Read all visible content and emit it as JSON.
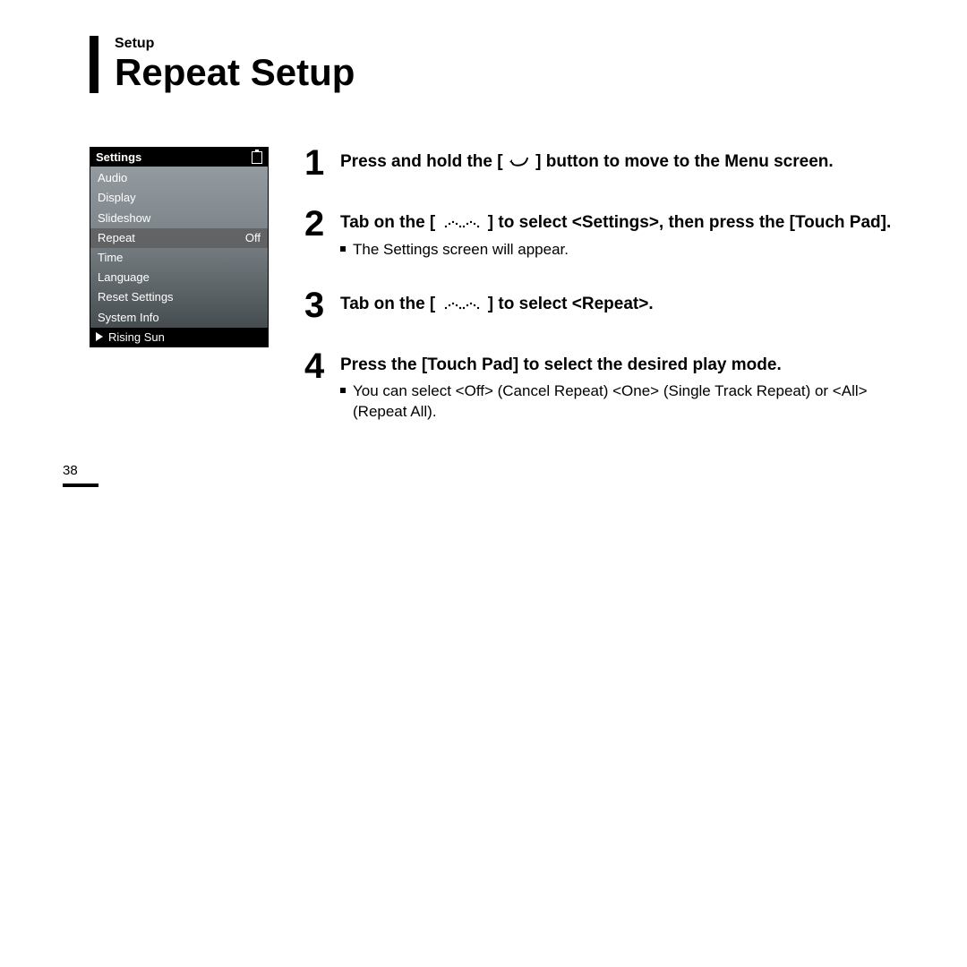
{
  "header": {
    "section_label": "Setup",
    "title": "Repeat Setup"
  },
  "device": {
    "header_title": "Settings",
    "items": [
      {
        "label": "Audio",
        "value": ""
      },
      {
        "label": "Display",
        "value": ""
      },
      {
        "label": "Slideshow",
        "value": ""
      },
      {
        "label": "Repeat",
        "value": "Off",
        "selected": true
      },
      {
        "label": "Time",
        "value": ""
      },
      {
        "label": "Language",
        "value": ""
      },
      {
        "label": "Reset Settings",
        "value": ""
      },
      {
        "label": "System Info",
        "value": ""
      }
    ],
    "now_playing": "Rising Sun"
  },
  "steps": [
    {
      "num": "1",
      "title_before": "Press and hold the [ ",
      "title_after": " ] button to move to the Menu screen.",
      "icon": "return-arrow"
    },
    {
      "num": "2",
      "title_before": "Tab on the [ ",
      "title_after": " ] to select <Settings>, then press the [Touch Pad].",
      "icon": "scroll-dots",
      "sub": "The Settings screen will appear."
    },
    {
      "num": "3",
      "title_before": "Tab on the [ ",
      "title_after": " ] to select <Repeat>.",
      "icon": "scroll-dots"
    },
    {
      "num": "4",
      "title_plain": "Press the [Touch Pad] to select the desired play mode.",
      "sub": "You can select <Off> (Cancel Repeat) <One> (Single Track Repeat) or <All> (Repeat All)."
    }
  ],
  "page_number": "38"
}
